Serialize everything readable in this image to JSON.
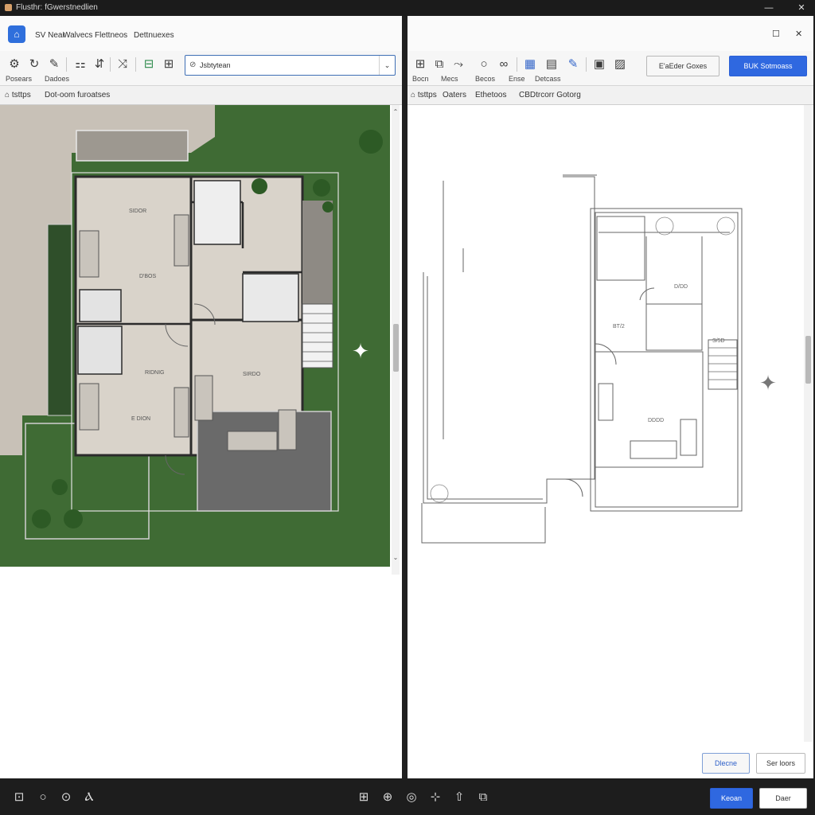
{
  "window": {
    "title": "Flusthr: fGwerstnedlien",
    "minimize_glyph": "—",
    "close_glyph": "✕"
  },
  "left": {
    "menu": [
      "SV Near",
      "Walvecs",
      "Flettneos",
      "Dettnuexes"
    ],
    "logo_glyph": "⌂",
    "tool_labels": [
      "Posears",
      "Dadoes"
    ],
    "search": {
      "value": "Jsbtytean",
      "chev": "⌄"
    },
    "tabs": [
      "tsttps",
      "Dot-oom furoatses"
    ],
    "rooms": [
      "SIDOR",
      "D'BOS",
      "RIDNIG",
      "SIRDO",
      "E DION"
    ],
    "scroll_up": "⌃",
    "scroll_down": "⌄",
    "sparkle": "✦"
  },
  "right": {
    "restore_glyph": "☐",
    "close_glyph": "✕",
    "tool_labels": [
      "Bocn",
      "Mecs",
      "Becos",
      "Ense",
      "Detcass"
    ],
    "buttons": {
      "secondary": "E'aEder Goxes",
      "primary": "BUK Sotmoass"
    },
    "tabs": [
      "tsttps",
      "Oaters",
      "Ethetoos",
      "CBDtrcorr Gotorg"
    ],
    "rooms": [
      "D/DD",
      "BT/2",
      "DDDD",
      "S/5D"
    ],
    "sparkle": "✦",
    "footer": {
      "left_button": "Dlecne",
      "right_button": "Ser loors"
    }
  },
  "bottom": {
    "left_icons": [
      "⊡",
      "○",
      "⊙",
      "Ⲁ"
    ],
    "center_icons": [
      "⊞",
      "⊕",
      "◎",
      "⊹",
      "⇧",
      "⧉"
    ],
    "buttons": {
      "primary": "Keoan",
      "secondary": "Daer"
    }
  },
  "colors": {
    "accent": "#2f68e0",
    "grass": "#3f6b34",
    "paving": "#c8c1b7",
    "floor": "#d9d3ca",
    "wall": "#2b2b2b",
    "terrace": "#6a6a6a"
  }
}
